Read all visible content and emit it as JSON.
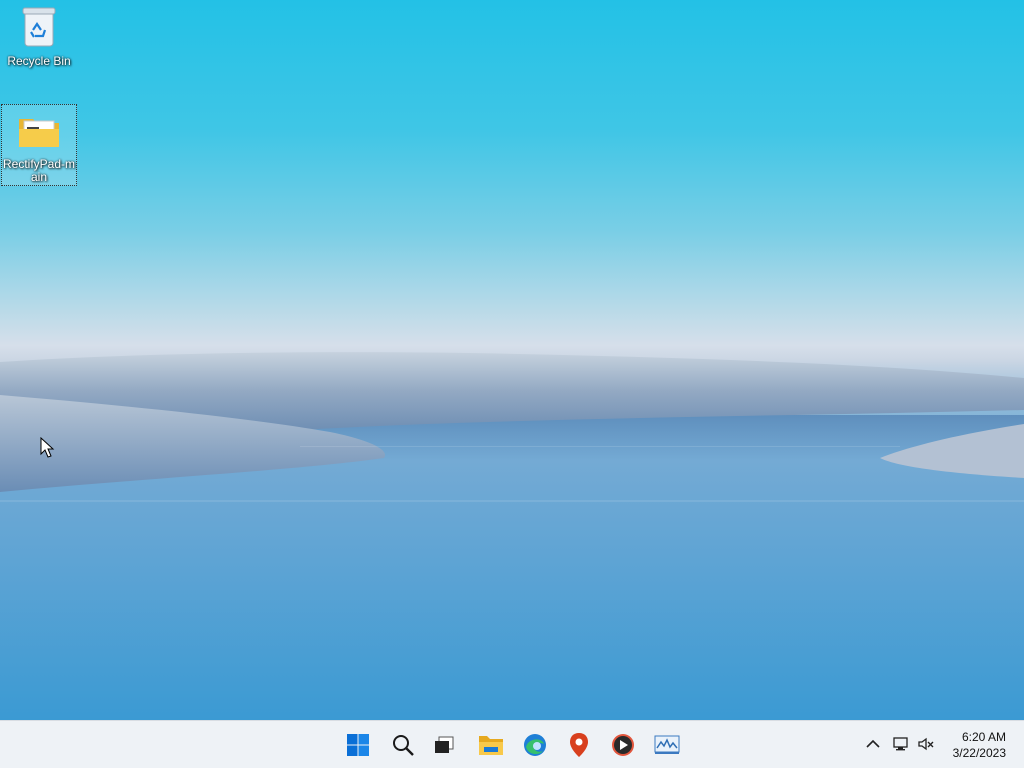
{
  "desktop": {
    "icons": [
      {
        "label": "Recycle Bin",
        "icon": "recycle-bin-icon"
      },
      {
        "label": "RectifyPad-main",
        "icon": "folder-icon",
        "selected": true
      }
    ]
  },
  "taskbar": {
    "pinned": [
      {
        "name": "start",
        "icon": "windows-logo-icon"
      },
      {
        "name": "search",
        "icon": "search-icon"
      },
      {
        "name": "task-view",
        "icon": "task-view-icon"
      },
      {
        "name": "file-explorer",
        "icon": "folder-icon"
      },
      {
        "name": "edge",
        "icon": "edge-browser-icon"
      },
      {
        "name": "maps",
        "icon": "map-pin-icon"
      },
      {
        "name": "media-player",
        "icon": "media-player-icon"
      },
      {
        "name": "performance-monitor",
        "icon": "chart-monitor-icon"
      }
    ],
    "tray": {
      "time": "6:20 AM",
      "date": "3/22/2023",
      "icons": [
        "chevron-up-icon",
        "network-icon",
        "speaker-muted-icon"
      ]
    }
  },
  "colors": {
    "sky_top": "#23c1e6",
    "water": "#3b9ad3",
    "taskbar_bg": "#eef2f6",
    "accent": "#0078d4"
  }
}
